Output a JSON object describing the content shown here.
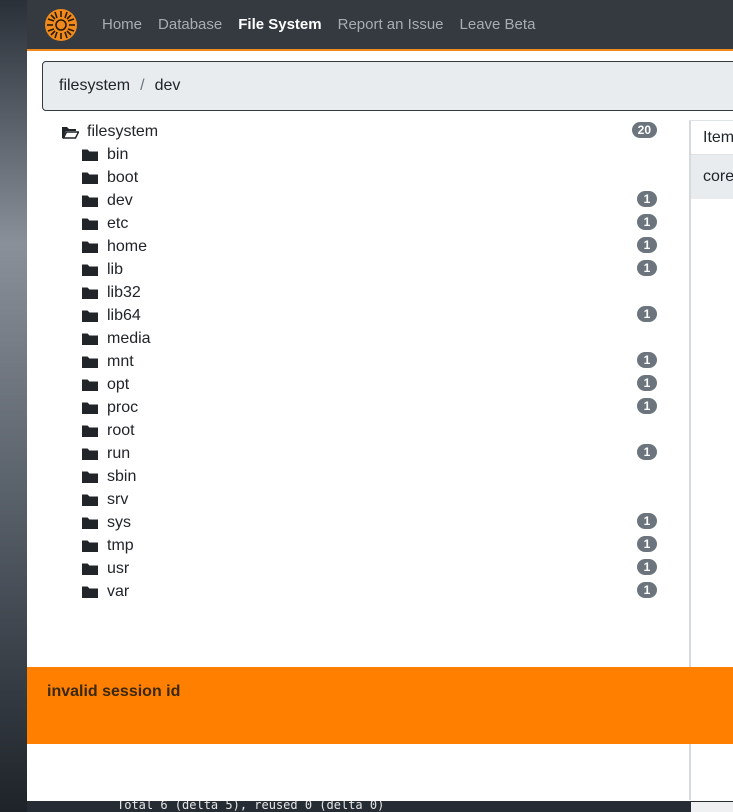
{
  "navbar": {
    "logo_icon": "sun-logo-icon",
    "links": [
      {
        "label": "Home",
        "active": false
      },
      {
        "label": "Database",
        "active": false
      },
      {
        "label": "File System",
        "active": true
      },
      {
        "label": "Report an Issue",
        "active": false
      },
      {
        "label": "Leave Beta",
        "active": false
      }
    ]
  },
  "breadcrumb": {
    "items": [
      "filesystem",
      "dev"
    ],
    "separator": "/"
  },
  "tree": {
    "root": {
      "label": "filesystem",
      "count": "20",
      "icon": "folder-open-icon"
    },
    "items": [
      {
        "label": "bin",
        "count": ""
      },
      {
        "label": "boot",
        "count": ""
      },
      {
        "label": "dev",
        "count": "1"
      },
      {
        "label": "etc",
        "count": "1"
      },
      {
        "label": "home",
        "count": "1"
      },
      {
        "label": "lib",
        "count": "1"
      },
      {
        "label": "lib32",
        "count": ""
      },
      {
        "label": "lib64",
        "count": "1"
      },
      {
        "label": "media",
        "count": ""
      },
      {
        "label": "mnt",
        "count": "1"
      },
      {
        "label": "opt",
        "count": "1"
      },
      {
        "label": "proc",
        "count": "1"
      },
      {
        "label": "root",
        "count": ""
      },
      {
        "label": "run",
        "count": "1"
      },
      {
        "label": "sbin",
        "count": ""
      },
      {
        "label": "srv",
        "count": ""
      },
      {
        "label": "sys",
        "count": "1"
      },
      {
        "label": "tmp",
        "count": "1"
      },
      {
        "label": "usr",
        "count": "1"
      },
      {
        "label": "var",
        "count": "1"
      }
    ]
  },
  "right_panel": {
    "header": "Item",
    "rows": [
      "core"
    ]
  },
  "alert": {
    "message": "invalid session id"
  },
  "background_terminal": {
    "text": "Total 6 (delta 5), reused 0 (delta 0)"
  },
  "colors": {
    "navbar": "#343a40",
    "accent": "#f08a1c",
    "alert": "#ff7f00",
    "badge": "#6c757d"
  }
}
